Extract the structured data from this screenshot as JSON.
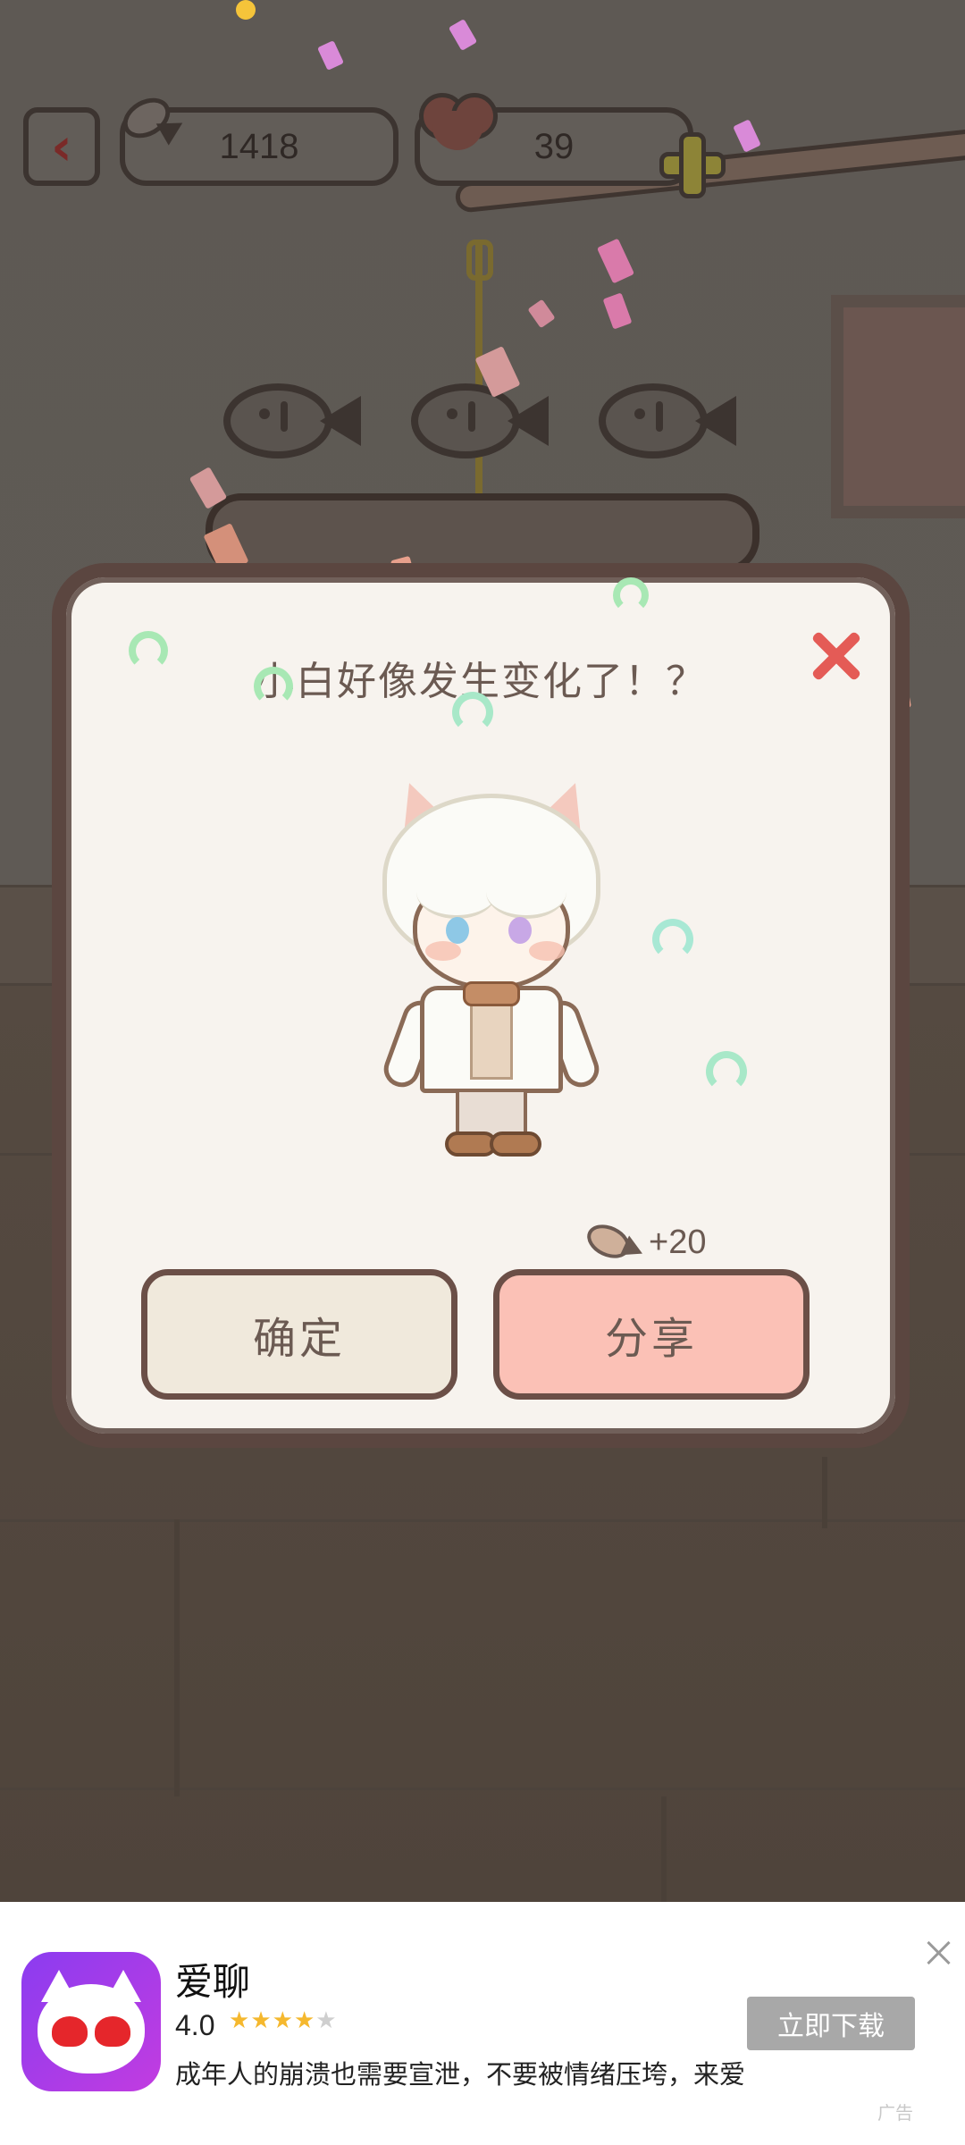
{
  "hud": {
    "back_icon": "chevron-left-icon",
    "fish_count": "1418",
    "heart_count": "39",
    "plus_icon": "plus-icon"
  },
  "dialog": {
    "title": "小白好像发生变化了！？",
    "close_icon": "close-icon",
    "reward_text": "+20",
    "confirm_label": "确定",
    "share_label": "分享"
  },
  "ad": {
    "app_name": "爱聊",
    "rating": "4.0",
    "stars": 4,
    "description": "成年人的崩溃也需要宣泄，不要被情绪压垮，来爱...",
    "download_label": "立即下载",
    "ad_tag": "广告"
  },
  "colors": {
    "accent_share": "#fbc1b6",
    "close_red": "#e45b56",
    "ad_button": "#a8a8a8"
  }
}
